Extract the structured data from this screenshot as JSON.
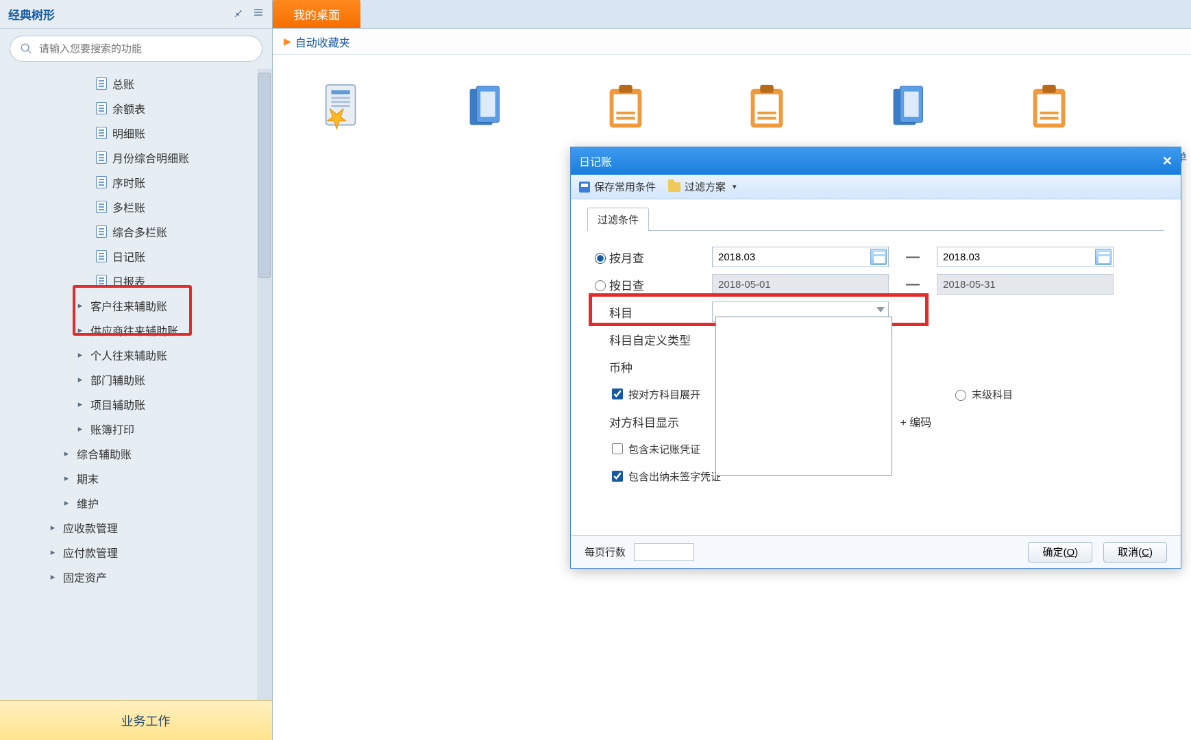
{
  "sidebar": {
    "title": "经典树形",
    "search_placeholder": "请输入您要搜索的功能",
    "items": [
      {
        "label": "总账",
        "type": "doc",
        "indent": "ind1"
      },
      {
        "label": "余额表",
        "type": "doc",
        "indent": "ind1"
      },
      {
        "label": "明细账",
        "type": "doc",
        "indent": "ind1"
      },
      {
        "label": "月份综合明细账",
        "type": "doc",
        "indent": "ind1"
      },
      {
        "label": "序时账",
        "type": "doc",
        "indent": "ind1"
      },
      {
        "label": "多栏账",
        "type": "doc",
        "indent": "ind1"
      },
      {
        "label": "综合多栏账",
        "type": "doc",
        "indent": "ind1"
      },
      {
        "label": "日记账",
        "type": "doc",
        "indent": "ind1"
      },
      {
        "label": "日报表",
        "type": "doc",
        "indent": "ind1"
      },
      {
        "label": "客户往来辅助账",
        "type": "expand",
        "indent": "ind2"
      },
      {
        "label": "供应商往来辅助账",
        "type": "expand",
        "indent": "ind2"
      },
      {
        "label": "个人往来辅助账",
        "type": "expand",
        "indent": "ind2"
      },
      {
        "label": "部门辅助账",
        "type": "expand",
        "indent": "ind2"
      },
      {
        "label": "项目辅助账",
        "type": "expand",
        "indent": "ind2"
      },
      {
        "label": "账簿打印",
        "type": "expand",
        "indent": "ind2"
      },
      {
        "label": "综合辅助账",
        "type": "expand",
        "indent": "ind3"
      },
      {
        "label": "期末",
        "type": "expand",
        "indent": "ind3"
      },
      {
        "label": "维护",
        "type": "expand",
        "indent": "ind3"
      },
      {
        "label": "应收款管理",
        "type": "expand",
        "indent": "ind4"
      },
      {
        "label": "应付款管理",
        "type": "expand",
        "indent": "ind4"
      },
      {
        "label": "固定资产",
        "type": "expand",
        "indent": "ind4"
      }
    ],
    "bottom": "业务工作"
  },
  "header": {
    "tab": "我的桌面",
    "favorites": "自动收藏夹",
    "right_link": "购单"
  },
  "dialog": {
    "title": "日记账",
    "toolbar": {
      "save": "保存常用条件",
      "plan": "过滤方案"
    },
    "filter_tab": "过滤条件",
    "rows": [
      {
        "label": "按月查",
        "from": "2018.03",
        "to": "2018.03"
      },
      {
        "label": "按日查",
        "from": "2018-05-01",
        "to": "2018-05-31"
      }
    ],
    "subject_label": "科目",
    "subject_type_label": "科目自定义类型",
    "currency_label": "币种",
    "expand_check": "按对方科目展开",
    "end_level_label": "末级科目",
    "opposite_label": "对方科目显示",
    "opposite_suffix": " + 编码",
    "include_unposted": "包含未记账凭证",
    "include_unsigned": "包含出纳未签字凭证",
    "footer": {
      "rows_label": "每页行数",
      "ok": "确定",
      "ok_key": "O",
      "cancel": "取消",
      "cancel_key": "C"
    }
  }
}
